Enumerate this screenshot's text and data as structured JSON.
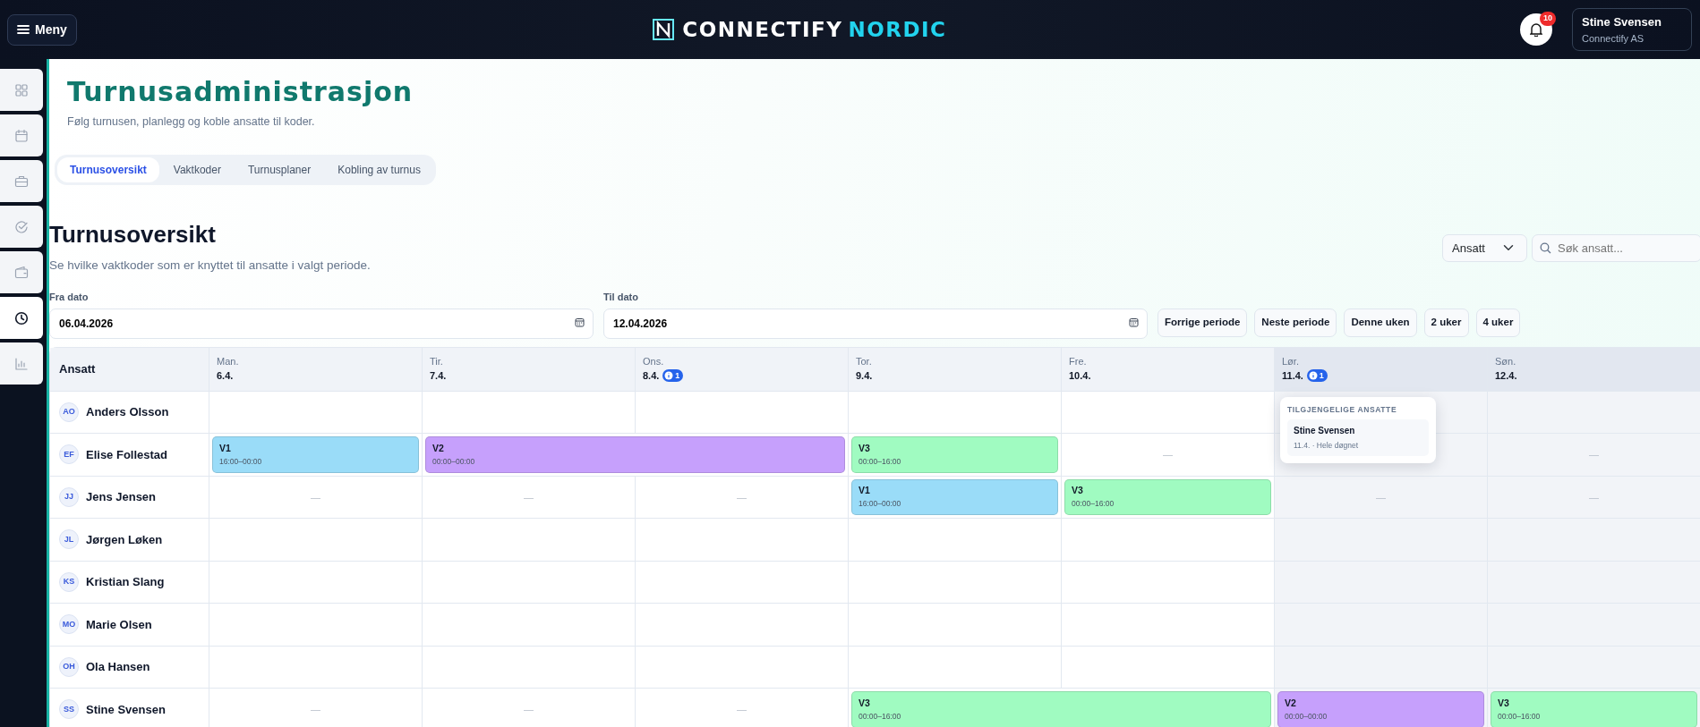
{
  "header": {
    "menu_button": "Meny",
    "logo": {
      "primary": "CONNECTIFY",
      "secondary": "NORDIC"
    },
    "notifications": "10",
    "user": {
      "name": "Stine Svensen",
      "company": "Connectify AS"
    }
  },
  "sidebar": {
    "items": [
      {
        "kind": "grid",
        "selected": false
      },
      {
        "kind": "calendar",
        "selected": false
      },
      {
        "kind": "briefcase",
        "selected": false
      },
      {
        "kind": "check",
        "selected": false
      },
      {
        "kind": "wallet",
        "selected": false
      },
      {
        "kind": "clock",
        "selected": true
      },
      {
        "kind": "chart",
        "selected": false
      }
    ]
  },
  "page": {
    "title": "Turnusadministrasjon",
    "subtitle": "Følg turnusen, planlegg og koble ansatte til koder."
  },
  "tabs": [
    {
      "label": "Turnusoversikt",
      "selected": true
    },
    {
      "label": "Vaktkoder",
      "selected": false
    },
    {
      "label": "Turnusplaner",
      "selected": false
    },
    {
      "label": "Kobling av turnus",
      "selected": false
    }
  ],
  "section": {
    "title": "Turnusoversikt",
    "description": "Se hvilke vaktkoder som er knyttet til ansatte i valgt periode.",
    "group_select": "Ansatt",
    "search": {
      "placeholder": "Søk ansatt..."
    }
  },
  "period": {
    "from": {
      "label": "Fra dato",
      "value": "06.04.2026"
    },
    "to": {
      "label": "Til dato",
      "value": "12.04.2026"
    },
    "buttons": [
      "Forrige periode",
      "Neste periode",
      "Denne uken",
      "2 uker",
      "4 uker"
    ]
  },
  "table": {
    "first_column": "Ansatt",
    "days": [
      {
        "weekday": "Man.",
        "date": "6.4.",
        "weekend": false
      },
      {
        "weekday": "Tir.",
        "date": "7.4.",
        "weekend": false
      },
      {
        "weekday": "Ons.",
        "date": "8.4.",
        "weekend": false,
        "badge": "1"
      },
      {
        "weekday": "Tor.",
        "date": "9.4.",
        "weekend": false
      },
      {
        "weekday": "Fre.",
        "date": "10.4.",
        "weekend": false
      },
      {
        "weekday": "Lør.",
        "date": "11.4.",
        "weekend": true,
        "badge": "1",
        "popover": {
          "title": "TILGJENGELIGE ANSATTE",
          "items": [
            {
              "name": "Stine Svensen",
              "detail": "11.4. · Hele døgnet"
            }
          ]
        }
      },
      {
        "weekday": "Søn.",
        "date": "12.4.",
        "weekend": true
      }
    ],
    "rows": [
      {
        "initials": "AO",
        "name": "Anders Olsson",
        "cells": [
          "",
          "",
          "",
          "",
          "",
          "",
          ""
        ]
      },
      {
        "initials": "EF",
        "name": "Elise Follestad",
        "cells": [
          {
            "kind": "shift",
            "code": "V1",
            "time": "16:00–00:00",
            "color": "#9adcf8"
          },
          {
            "kind": "shift",
            "code": "V2",
            "time": "00:00–00:00",
            "color": "#c6a0fc"
          },
          {
            "kind": "continued"
          },
          {
            "kind": "shift",
            "code": "V3",
            "time": "00:00–16:00",
            "color": "#a0fbc1"
          },
          "—",
          "",
          "—"
        ]
      },
      {
        "initials": "JJ",
        "name": "Jens Jensen",
        "cells": [
          "—",
          "—",
          "—",
          {
            "kind": "shift",
            "code": "V1",
            "time": "16:00–00:00",
            "color": "#9adcf8"
          },
          {
            "kind": "shift",
            "code": "V3",
            "time": "00:00–16:00",
            "color": "#a0fbc1"
          },
          "—",
          "—"
        ]
      },
      {
        "initials": "JL",
        "name": "Jørgen Løken",
        "cells": [
          "",
          "",
          "",
          "",
          "",
          "",
          ""
        ]
      },
      {
        "initials": "KS",
        "name": "Kristian Slang",
        "cells": [
          "",
          "",
          "",
          "",
          "",
          "",
          ""
        ]
      },
      {
        "initials": "MO",
        "name": "Marie Olsen",
        "cells": [
          "",
          "",
          "",
          "",
          "",
          "",
          ""
        ]
      },
      {
        "initials": "OH",
        "name": "Ola Hansen",
        "cells": [
          "",
          "",
          "",
          "",
          "",
          "",
          ""
        ]
      },
      {
        "initials": "SS",
        "name": "Stine Svensen",
        "cells": [
          "—",
          "—",
          "—",
          {
            "kind": "shift",
            "code": "V3",
            "time": "00:00–16:00",
            "color": "#a0fbc1"
          },
          {
            "kind": "continued"
          },
          {
            "kind": "shift",
            "code": "V2",
            "time": "00:00–00:00",
            "color": "#c6a0fc"
          },
          {
            "kind": "shift",
            "code": "V3",
            "time": "00:00–16:00",
            "color": "#a0fbc1"
          }
        ]
      }
    ]
  }
}
